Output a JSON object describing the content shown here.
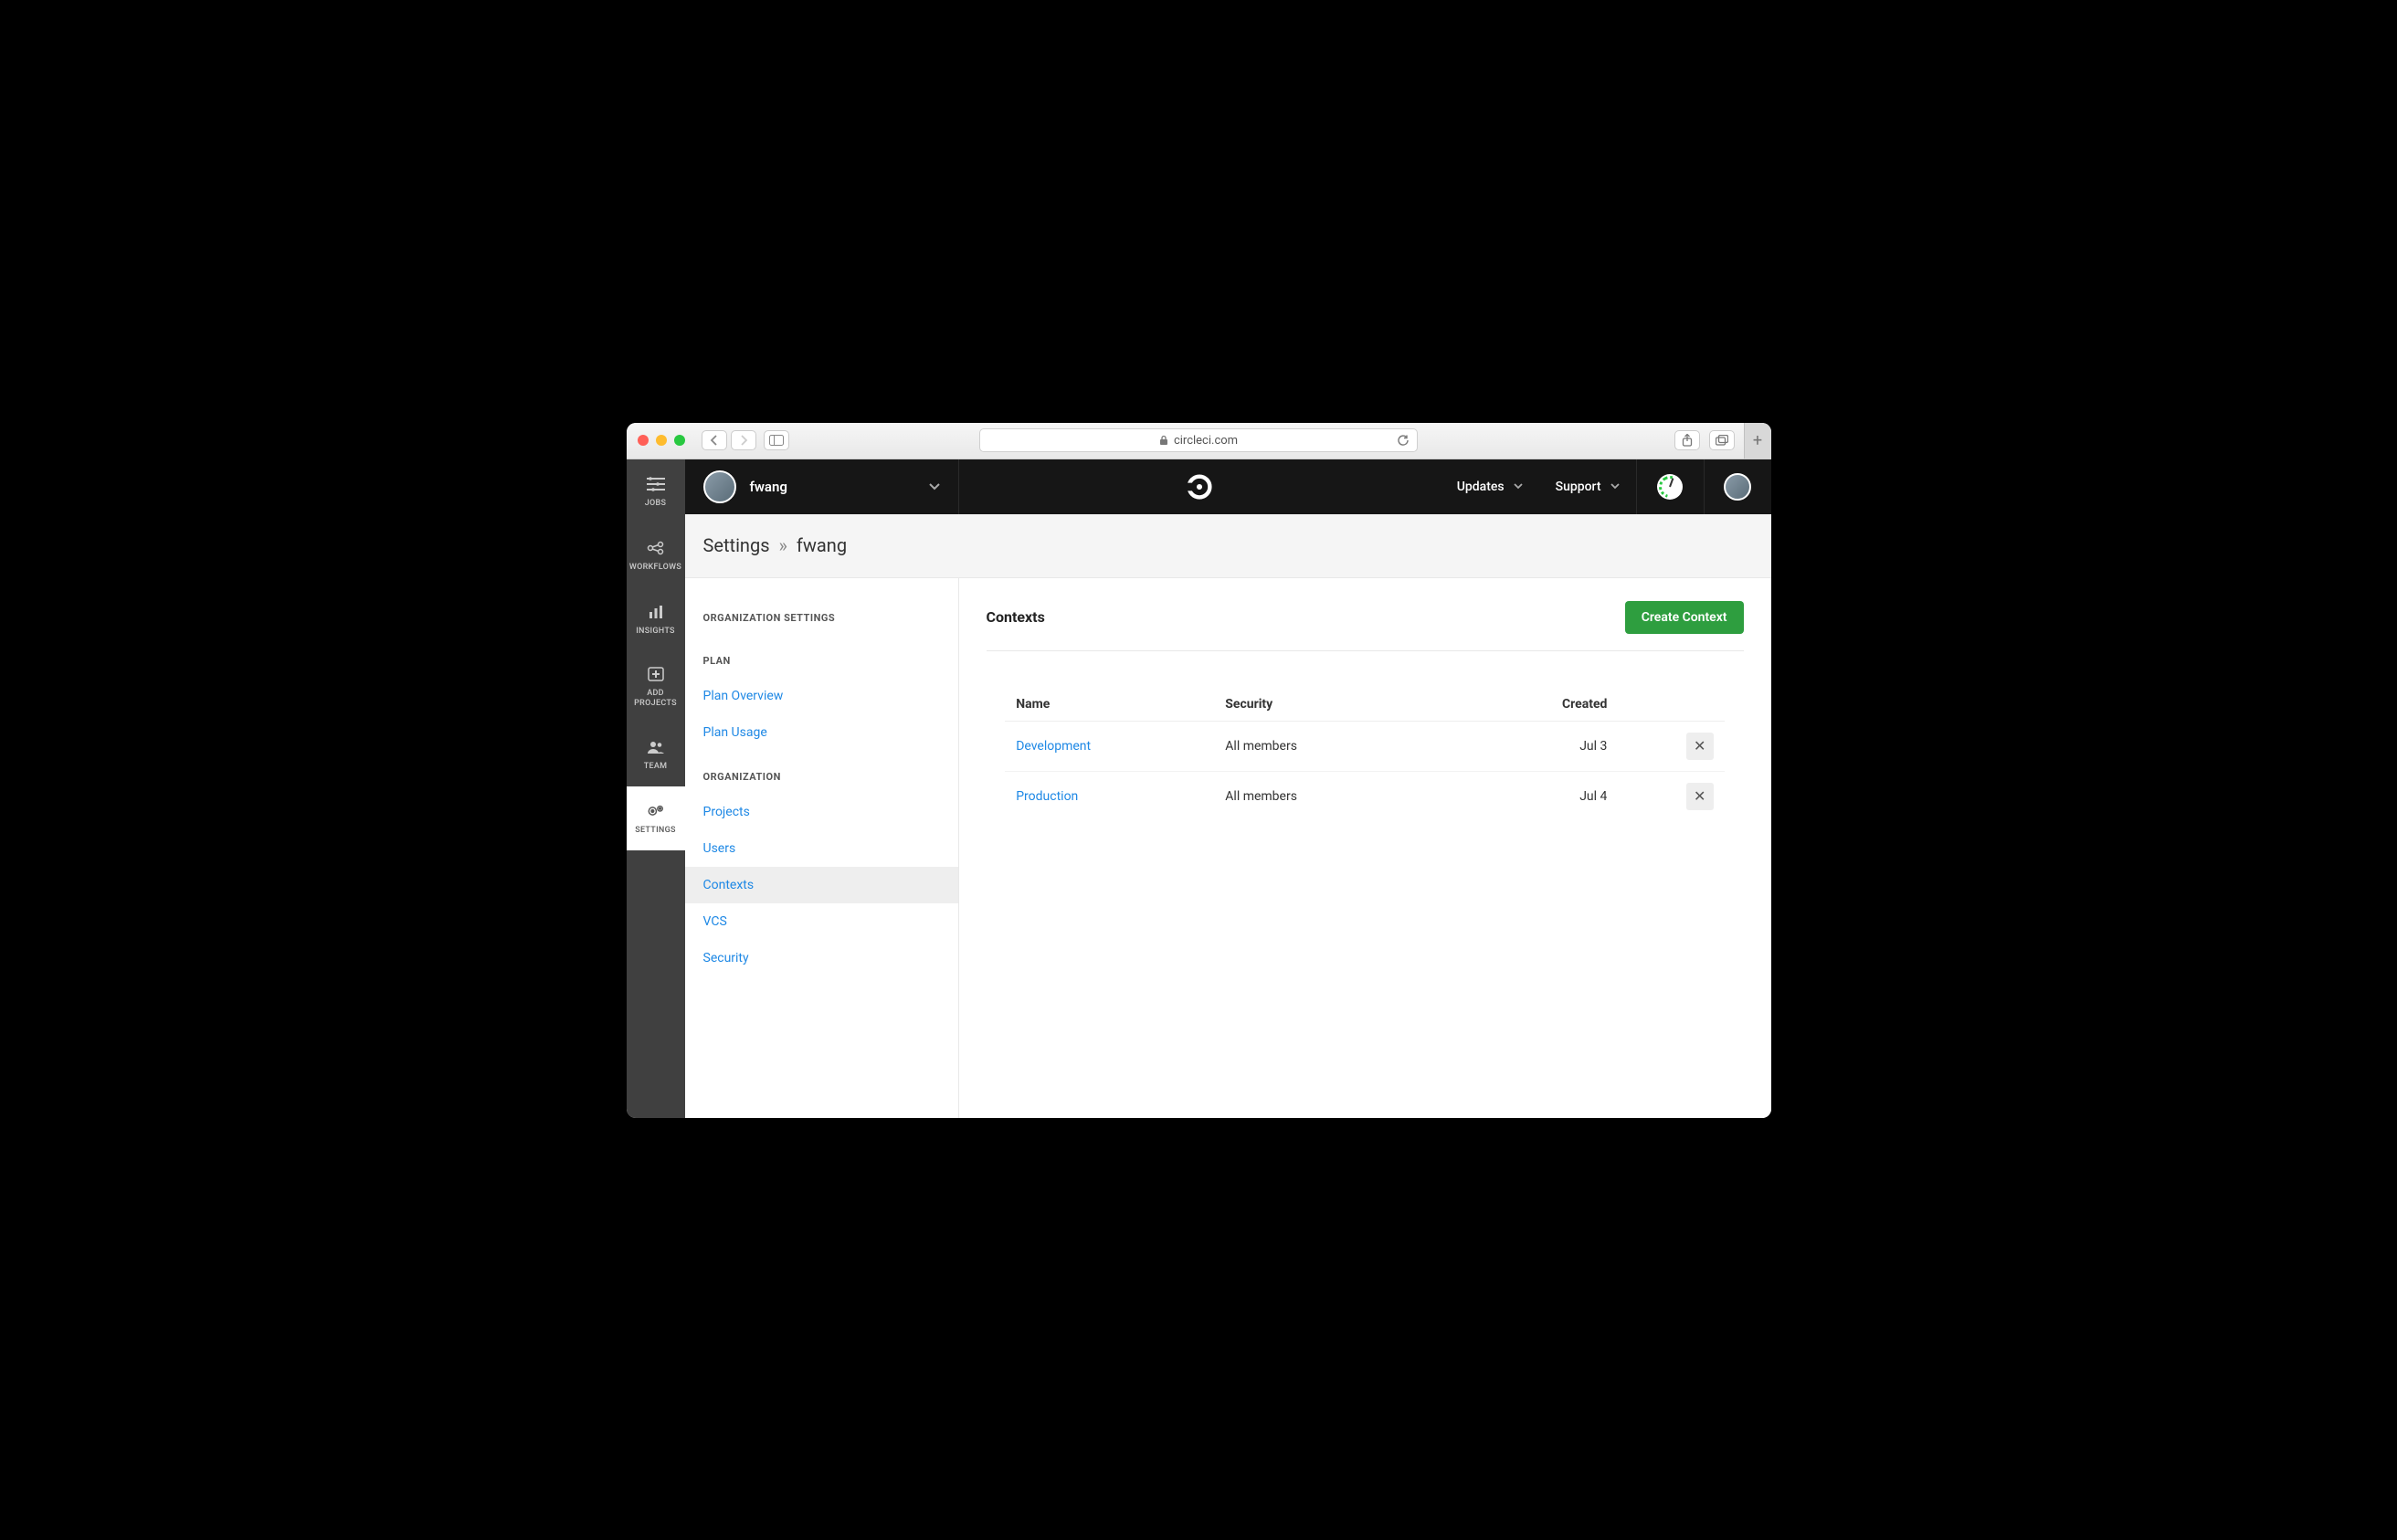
{
  "browser": {
    "url_host": "circleci.com",
    "lock_icon": "lock-icon"
  },
  "topbar": {
    "org_name": "fwang",
    "links": {
      "updates": "Updates",
      "support": "Support"
    }
  },
  "rail": {
    "jobs": "JOBS",
    "workflows": "WORKFLOWS",
    "insights": "INSIGHTS",
    "add_projects_l1": "ADD",
    "add_projects_l2": "PROJECTS",
    "team": "TEAM",
    "settings": "SETTINGS"
  },
  "breadcrumb": {
    "root": "Settings",
    "sep": "»",
    "current": "fwang"
  },
  "sidebar": {
    "section_org_settings": "ORGANIZATION SETTINGS",
    "section_plan": "PLAN",
    "plan_overview": "Plan Overview",
    "plan_usage": "Plan Usage",
    "section_organization": "ORGANIZATION",
    "projects": "Projects",
    "users": "Users",
    "contexts": "Contexts",
    "vcs": "VCS",
    "security": "Security"
  },
  "page": {
    "title": "Contexts",
    "create_button": "Create Context",
    "columns": {
      "name": "Name",
      "security": "Security",
      "created": "Created"
    },
    "rows": [
      {
        "name": "Development",
        "security": "All members",
        "created": "Jul 3"
      },
      {
        "name": "Production",
        "security": "All members",
        "created": "Jul 4"
      }
    ]
  }
}
